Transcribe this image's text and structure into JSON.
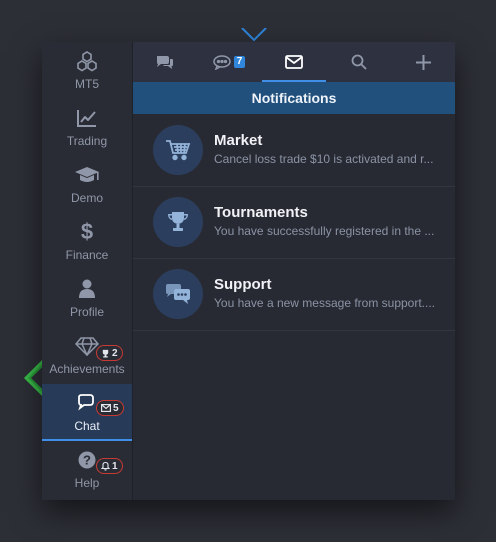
{
  "colors": {
    "accent": "#3f8fe8",
    "header_bg": "#22507c",
    "badge_border": "#c63a33",
    "arrow_green": "#3bbf4b"
  },
  "sidebar": {
    "items": [
      {
        "label": "MT5",
        "icon": "cubes-icon"
      },
      {
        "label": "Trading",
        "icon": "line-chart-icon"
      },
      {
        "label": "Demo",
        "icon": "graduation-cap-icon"
      },
      {
        "label": "Finance",
        "icon": "dollar-icon"
      },
      {
        "label": "Profile",
        "icon": "user-icon"
      },
      {
        "label": "Achievements",
        "icon": "diamond-icon",
        "badge": "2",
        "badge_icon": "trophy-icon"
      },
      {
        "label": "Chat",
        "icon": "chat-icon",
        "badge": "5",
        "badge_icon": "envelope-icon",
        "active": true
      },
      {
        "label": "Help",
        "icon": "question-icon",
        "badge": "1",
        "badge_icon": "bell-icon"
      }
    ]
  },
  "tabs": [
    {
      "icon": "chat-bubbles-icon"
    },
    {
      "icon": "comment-dots-icon",
      "count": "7"
    },
    {
      "icon": "envelope-icon",
      "active": true
    },
    {
      "icon": "search-icon"
    },
    {
      "icon": "plus-icon"
    }
  ],
  "notifications": {
    "title": "Notifications",
    "items": [
      {
        "title": "Market",
        "message": "Cancel loss trade $10 is activated and r...",
        "icon": "cart-icon"
      },
      {
        "title": "Tournaments",
        "message": "You have successfully registered in the ...",
        "icon": "trophy-icon"
      },
      {
        "title": "Support",
        "message": "You have a new message from support....",
        "icon": "support-chat-icon"
      }
    ]
  }
}
